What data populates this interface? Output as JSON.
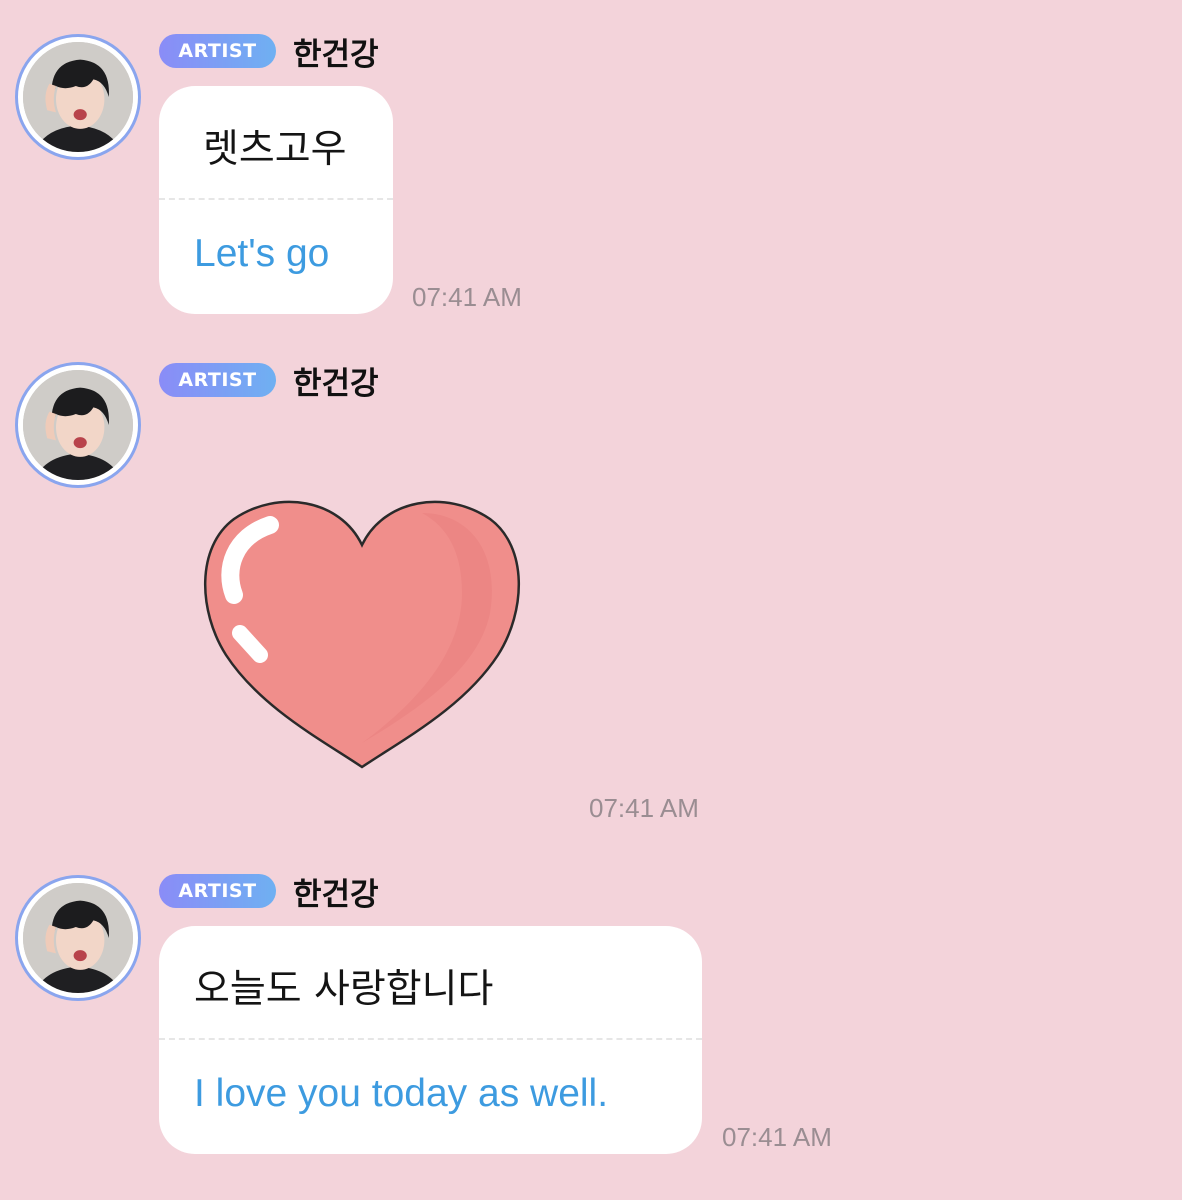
{
  "messages": [
    {
      "badge": "ARTIST",
      "sender": "한건강",
      "original": "렛츠고우",
      "translation": "Let's go",
      "time": "07:41 AM"
    },
    {
      "badge": "ARTIST",
      "sender": "한건강",
      "sticker": "heart-sticker",
      "time": "07:41 AM"
    },
    {
      "badge": "ARTIST",
      "sender": "한건강",
      "original": "오늘도 사랑합니다",
      "translation": "I love you today as well.",
      "time": "07:41 AM"
    }
  ],
  "colors": {
    "background": "#f3d3da",
    "translation_text": "#3d9be0",
    "badge_gradient_start": "#8a8cf7",
    "badge_gradient_end": "#6fb0f2",
    "heart_fill": "#f08e8b"
  }
}
